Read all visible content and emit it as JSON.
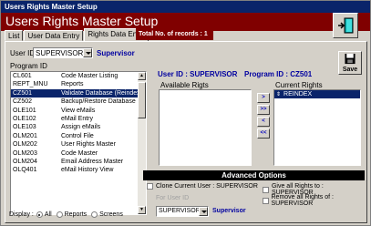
{
  "window": {
    "title": "Users Rights Master Setup"
  },
  "header": {
    "title": "Users Rights Master Setup",
    "total_records": "Total No. of records : 1"
  },
  "tabs": [
    {
      "label": "List"
    },
    {
      "label": "User Data Entry"
    },
    {
      "label": "Rights Data Entry"
    }
  ],
  "form": {
    "user_id_label": "User ID",
    "user_id_value": "SUPERVISOR",
    "user_id_name": "Supervisor",
    "program_id_label": "Program ID",
    "current_user_text": "User ID : SUPERVISOR",
    "current_program_text": "Program ID : CZ501",
    "available_rights_label": "Available Rigts",
    "current_rights_label": "Current Rights",
    "save_label": "Save"
  },
  "programs": [
    {
      "id": "CL601",
      "name": "Code Master Listing"
    },
    {
      "id": "REPT_MNU",
      "name": "Reports"
    },
    {
      "id": "CZ501",
      "name": "Validate Database (Reindex)",
      "selected": true
    },
    {
      "id": "CZ502",
      "name": "Backup/Restore Database"
    },
    {
      "id": "OLE101",
      "name": "View eMails"
    },
    {
      "id": "OLE102",
      "name": "eMail Entry"
    },
    {
      "id": "OLE103",
      "name": "Assign eMails"
    },
    {
      "id": "OLM201",
      "name": "Control File"
    },
    {
      "id": "OLM202",
      "name": "User Rights Master"
    },
    {
      "id": "OLM203",
      "name": "Code Master"
    },
    {
      "id": "OLM204",
      "name": "Email Address Master"
    },
    {
      "id": "OLQ401",
      "name": "eMail History View"
    }
  ],
  "current_rights": [
    "REINDEX"
  ],
  "move_buttons": [
    ">",
    ">>",
    "<",
    "<<"
  ],
  "advanced": {
    "title": "Advanced Options",
    "clone_label": "Clone Current User : SUPERVISOR",
    "give_all_label": "Give all Rights to : SUPERVISOR",
    "remove_all_label": "Remove all Rights of : SUPERVISOR",
    "for_user_label": "For User ID",
    "for_user_value": "SUPERVISOR",
    "for_user_name": "Supervisor"
  },
  "display": {
    "label": "Display :",
    "options": [
      "All",
      "Reports",
      "Screens"
    ],
    "selected": "All"
  }
}
